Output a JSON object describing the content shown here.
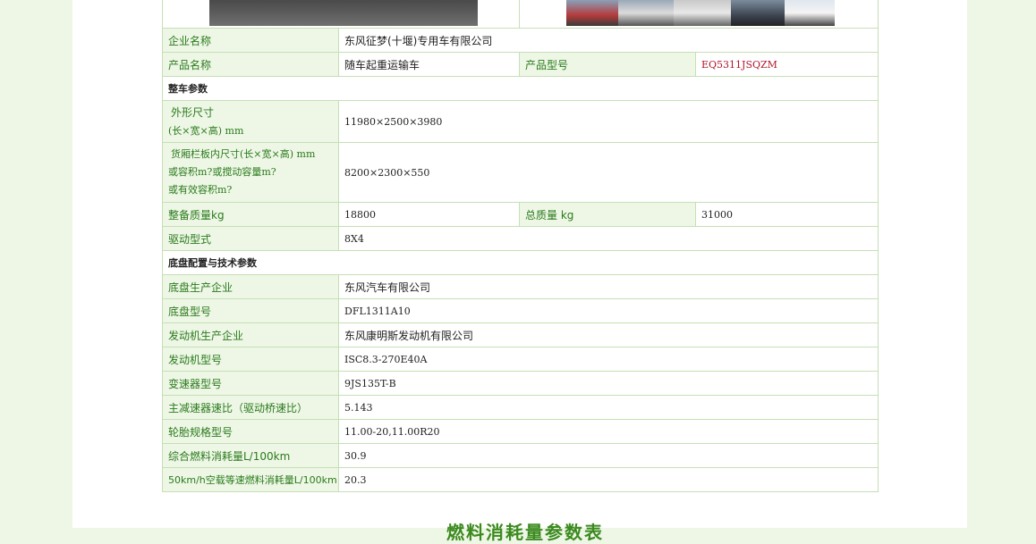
{
  "company": {
    "label": "企业名称",
    "value": "东风征梦(十堰)专用车有限公司"
  },
  "product": {
    "name_label": "产品名称",
    "name_value": "随车起重运输车",
    "model_label": "产品型号",
    "model_value": "EQ5311JSQZM"
  },
  "vehicle_section": {
    "title": "整车参数",
    "dimensions": {
      "label_line1": "外形尺寸",
      "label_line2": "(长×宽×高) mm",
      "value": "11980×2500×3980"
    },
    "cargo": {
      "label_line1": "货厢栏板内尺寸(长×宽×高) mm",
      "label_line2": "或容积m?或搅动容量m?",
      "label_line3": "或有效容积m?",
      "value": "8200×2300×550"
    },
    "curb_weight": {
      "label": "整备质量kg",
      "value": "18800"
    },
    "total_weight": {
      "label": "总质量 kg",
      "value": "31000"
    },
    "drive": {
      "label": "驱动型式",
      "value": "8X4"
    }
  },
  "chassis_section": {
    "title": "底盘配置与技术参数",
    "rows": [
      {
        "label": "底盘生产企业",
        "value": "东风汽车有限公司",
        "cn": true
      },
      {
        "label": "底盘型号",
        "value": "DFL1311A10",
        "cn": false
      },
      {
        "label": "发动机生产企业",
        "value": "东风康明斯发动机有限公司",
        "cn": true
      },
      {
        "label": "发动机型号",
        "value": "ISC8.3-270E40A",
        "cn": false
      },
      {
        "label": "变速器型号",
        "value": "9JS135T-B",
        "cn": false
      },
      {
        "label": "主减速器速比（驱动桥速比）",
        "value": "5.143",
        "cn": false
      },
      {
        "label": "轮胎规格型号",
        "value": "11.00-20,11.00R20",
        "cn": false
      },
      {
        "label": "综合燃料消耗量L/100km",
        "value": "30.9",
        "cn": false
      },
      {
        "label": "50km/h空载等速燃料消耗量L/100km",
        "value": "20.3",
        "cn": false
      }
    ]
  },
  "footer": {
    "title": "燃料消耗量参数表"
  },
  "colors": {
    "label_bg": "#eef7e6",
    "label_text": "#2a7a1c",
    "border": "#c6dfb5",
    "model_text": "#b0162a",
    "page_bg": "#eef6e6"
  }
}
